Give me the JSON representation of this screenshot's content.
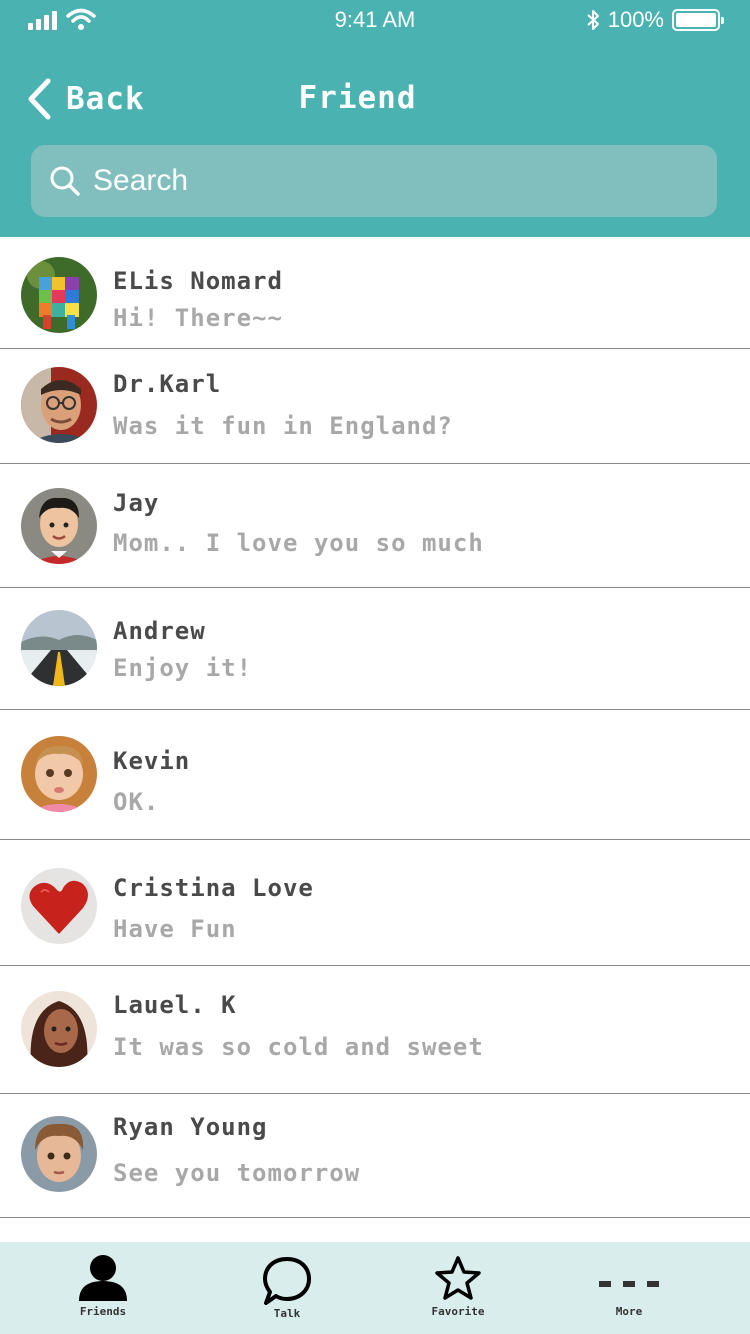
{
  "status_bar": {
    "time": "9:41 AM",
    "battery": "100%",
    "battery_level": 1.0
  },
  "nav": {
    "back_label": "Back",
    "title": "Friend"
  },
  "search": {
    "placeholder": "Search"
  },
  "friends": [
    {
      "name": "ELis Nomard",
      "message": "Hi! There~~",
      "avatar": "patchwork-elephant"
    },
    {
      "name": "Dr.Karl",
      "message": "Was it fun in England?",
      "avatar": "man-with-glasses"
    },
    {
      "name": "Jay",
      "message": "Mom.. I love you so much",
      "avatar": "boy"
    },
    {
      "name": "Andrew",
      "message": "Enjoy it!",
      "avatar": "snowy-road"
    },
    {
      "name": "Kevin",
      "message": "OK.",
      "avatar": "baby"
    },
    {
      "name": "Cristina Love",
      "message": "Have Fun",
      "avatar": "red-heart"
    },
    {
      "name": "Lauel. K",
      "message": "It was so cold and sweet",
      "avatar": "woman"
    },
    {
      "name": "Ryan Young",
      "message": "See you tomorrow",
      "avatar": "child"
    }
  ],
  "tabbar": {
    "friends_label": "Friends",
    "talk_label": "Talk",
    "favorite_label": "Favorite",
    "more_label": "More"
  },
  "colors": {
    "header": "#4ab2b0",
    "search_bg": "#80bfbd",
    "tabbar_bg": "#daeded",
    "name_text": "#4a4a4a",
    "message_text": "#a8a8a8"
  }
}
